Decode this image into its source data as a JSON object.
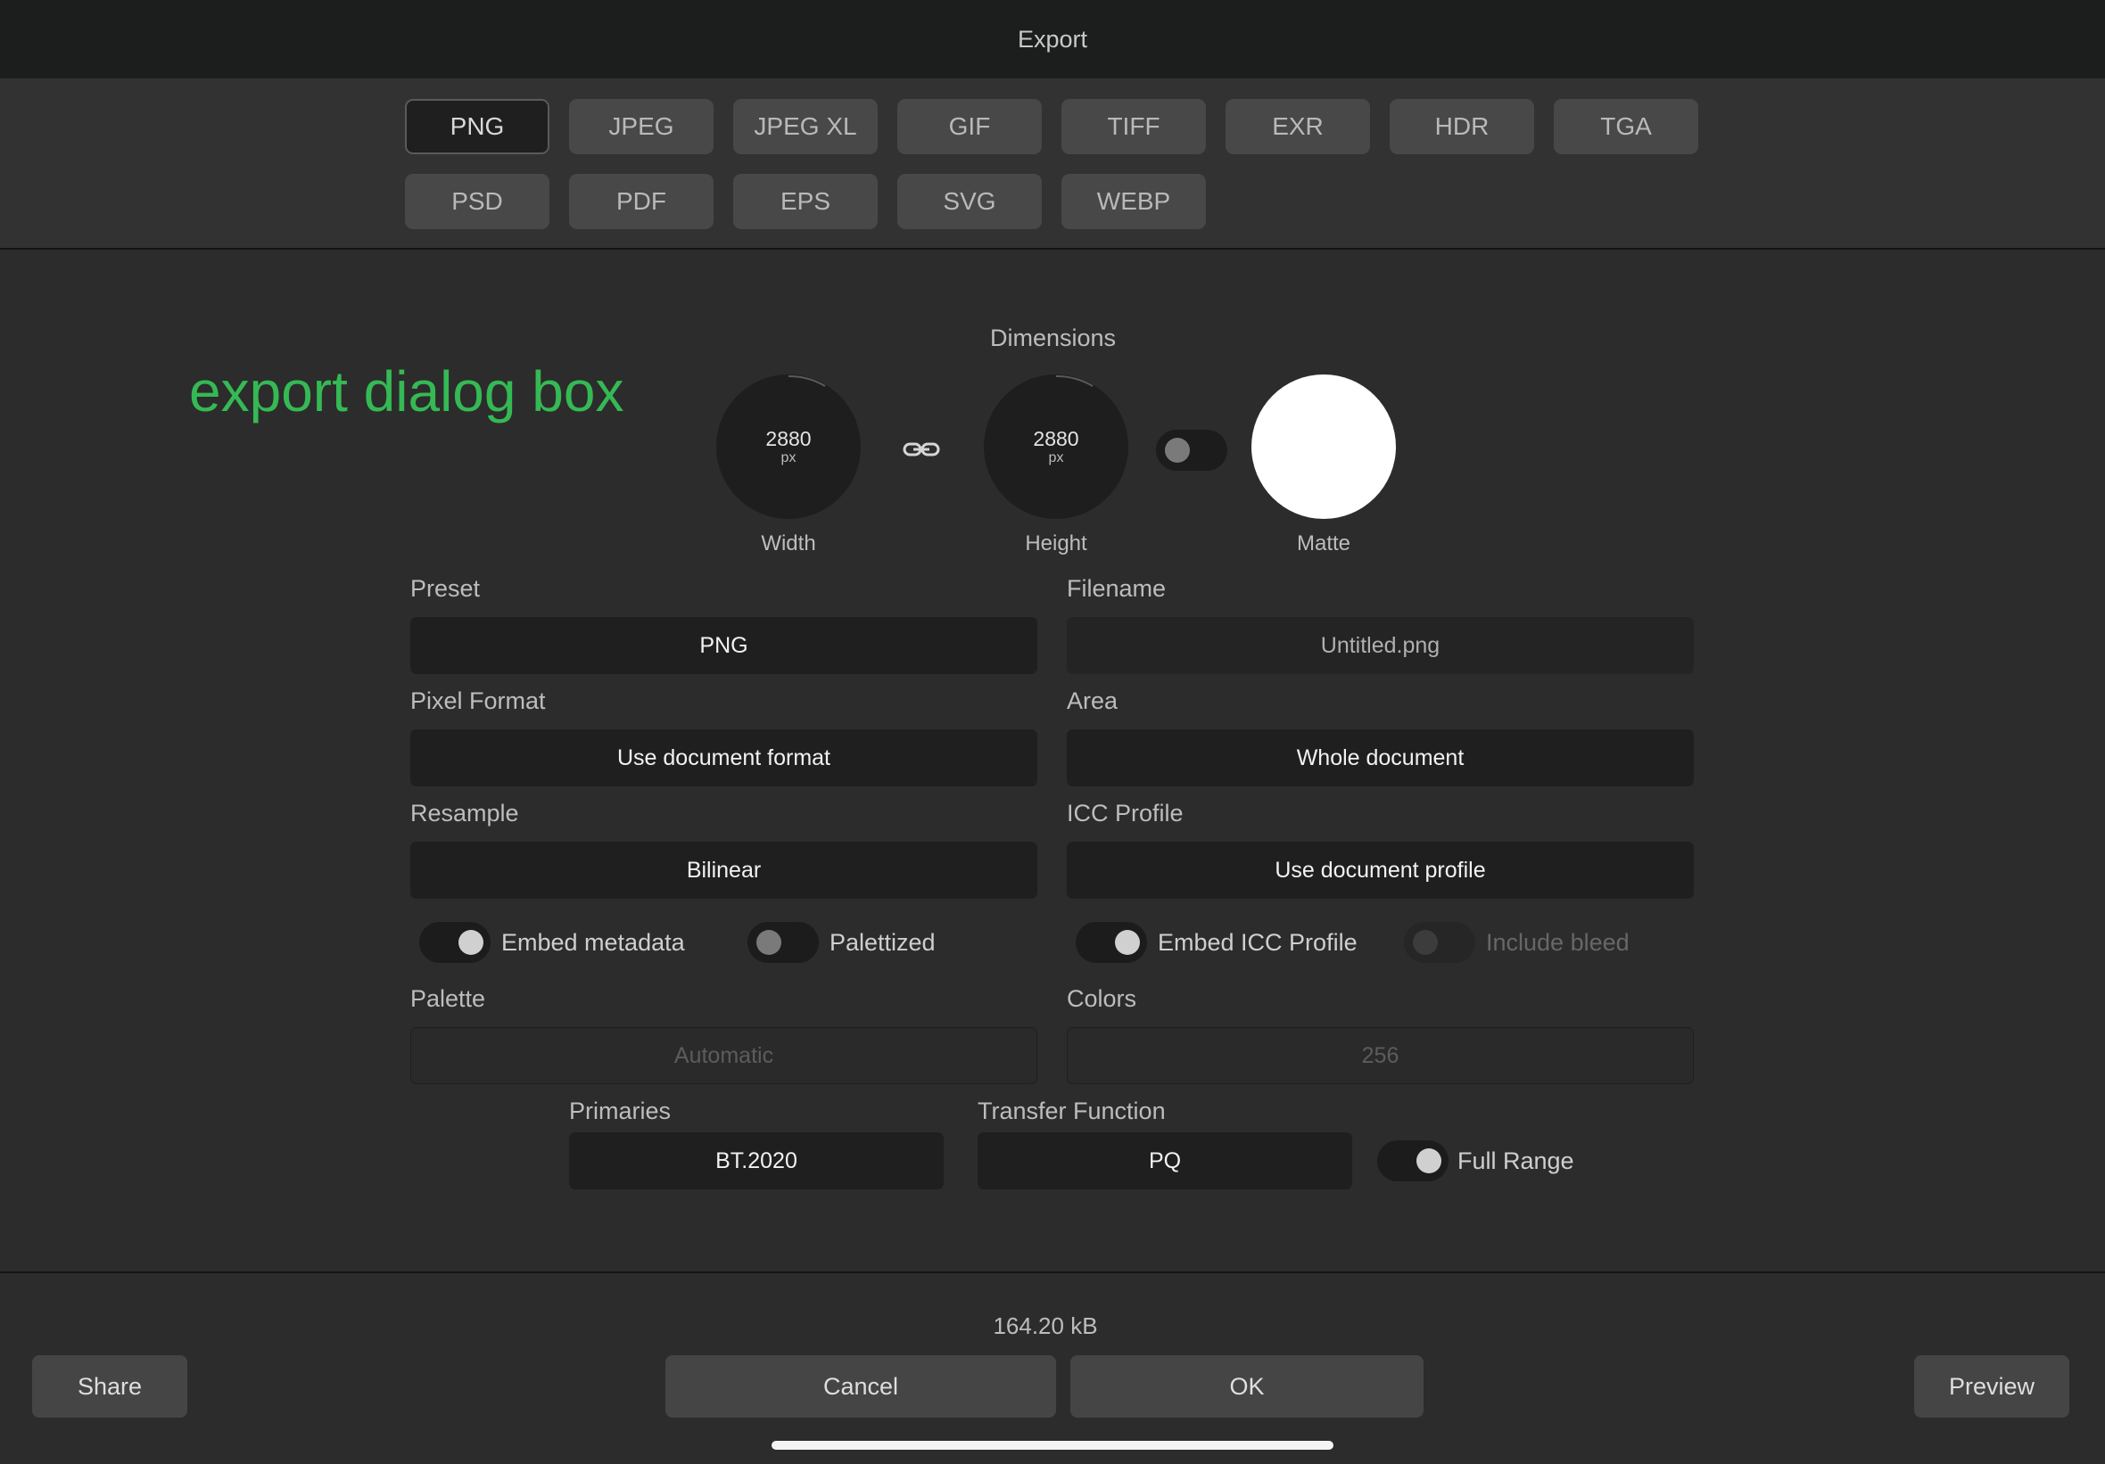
{
  "window": {
    "title": "Export"
  },
  "formats": [
    "PNG",
    "JPEG",
    "JPEG XL",
    "GIF",
    "TIFF",
    "EXR",
    "HDR",
    "TGA",
    "PSD",
    "PDF",
    "EPS",
    "SVG",
    "WEBP"
  ],
  "selected_format": "PNG",
  "overlay_text": "export dialog box",
  "dimensions": {
    "title": "Dimensions",
    "width": {
      "value": "2880",
      "unit": "px",
      "label": "Width"
    },
    "height": {
      "value": "2880",
      "unit": "px",
      "label": "Height"
    },
    "matte": {
      "label": "Matte",
      "color": "#ffffff"
    }
  },
  "fields": {
    "preset": {
      "label": "Preset",
      "value": "PNG"
    },
    "filename": {
      "label": "Filename",
      "value": "Untitled.png"
    },
    "pixel_format": {
      "label": "Pixel Format",
      "value": "Use document format"
    },
    "area": {
      "label": "Area",
      "value": "Whole document"
    },
    "resample": {
      "label": "Resample",
      "value": "Bilinear"
    },
    "icc_profile": {
      "label": "ICC Profile",
      "value": "Use document profile"
    },
    "palette": {
      "label": "Palette",
      "value": "Automatic"
    },
    "colors": {
      "label": "Colors",
      "value": "256"
    },
    "primaries": {
      "label": "Primaries",
      "value": "BT.2020"
    },
    "transfer_function": {
      "label": "Transfer Function",
      "value": "PQ"
    }
  },
  "toggles": {
    "embed_metadata": {
      "label": "Embed metadata",
      "on": true
    },
    "palettized": {
      "label": "Palettized",
      "on": false
    },
    "embed_icc": {
      "label": "Embed ICC Profile",
      "on": true
    },
    "include_bleed": {
      "label": "Include bleed",
      "on": false,
      "disabled": true
    },
    "full_range": {
      "label": "Full Range",
      "on": true
    }
  },
  "footer": {
    "file_size": "164.20 kB",
    "share_label": "Share",
    "cancel_label": "Cancel",
    "ok_label": "OK",
    "preview_label": "Preview"
  }
}
